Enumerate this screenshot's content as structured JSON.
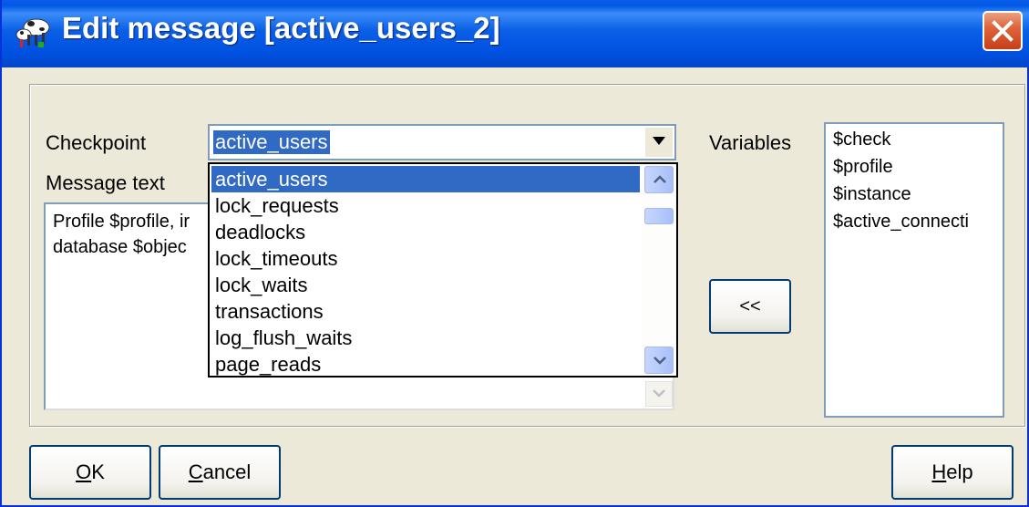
{
  "window": {
    "title": "Edit message [active_users_2]"
  },
  "checkpoint": {
    "label": "Checkpoint",
    "value": "active_users"
  },
  "message": {
    "label": "Message text",
    "lines": [
      "Profile $profile, ir",
      "database $objec"
    ]
  },
  "dropdown": {
    "items": [
      "active_users",
      "lock_requests",
      "deadlocks",
      "lock_timeouts",
      "lock_waits",
      "transactions",
      "log_flush_waits",
      "page_reads"
    ],
    "selected_index": 0
  },
  "variables": {
    "label": "Variables",
    "items": [
      "$check",
      "$profile",
      "$instance",
      "$active_connecti"
    ]
  },
  "buttons": {
    "insert": "<<",
    "ok_mnemonic": "O",
    "ok_rest": "K",
    "cancel_mnemonic": "C",
    "cancel_rest": "ancel",
    "help_mnemonic": "H",
    "help_rest": "elp"
  },
  "icons": {
    "app": "cows-app-icon",
    "close": "close-icon",
    "dropdown": "chevron-down-icon",
    "scroll_up": "chevron-up-icon",
    "scroll_down": "chevron-down-icon"
  },
  "colors": {
    "title_bar": "#0058e6",
    "selection": "#316ac5",
    "close_button": "#e0643a",
    "dialog_bg": "#ece9d8"
  }
}
